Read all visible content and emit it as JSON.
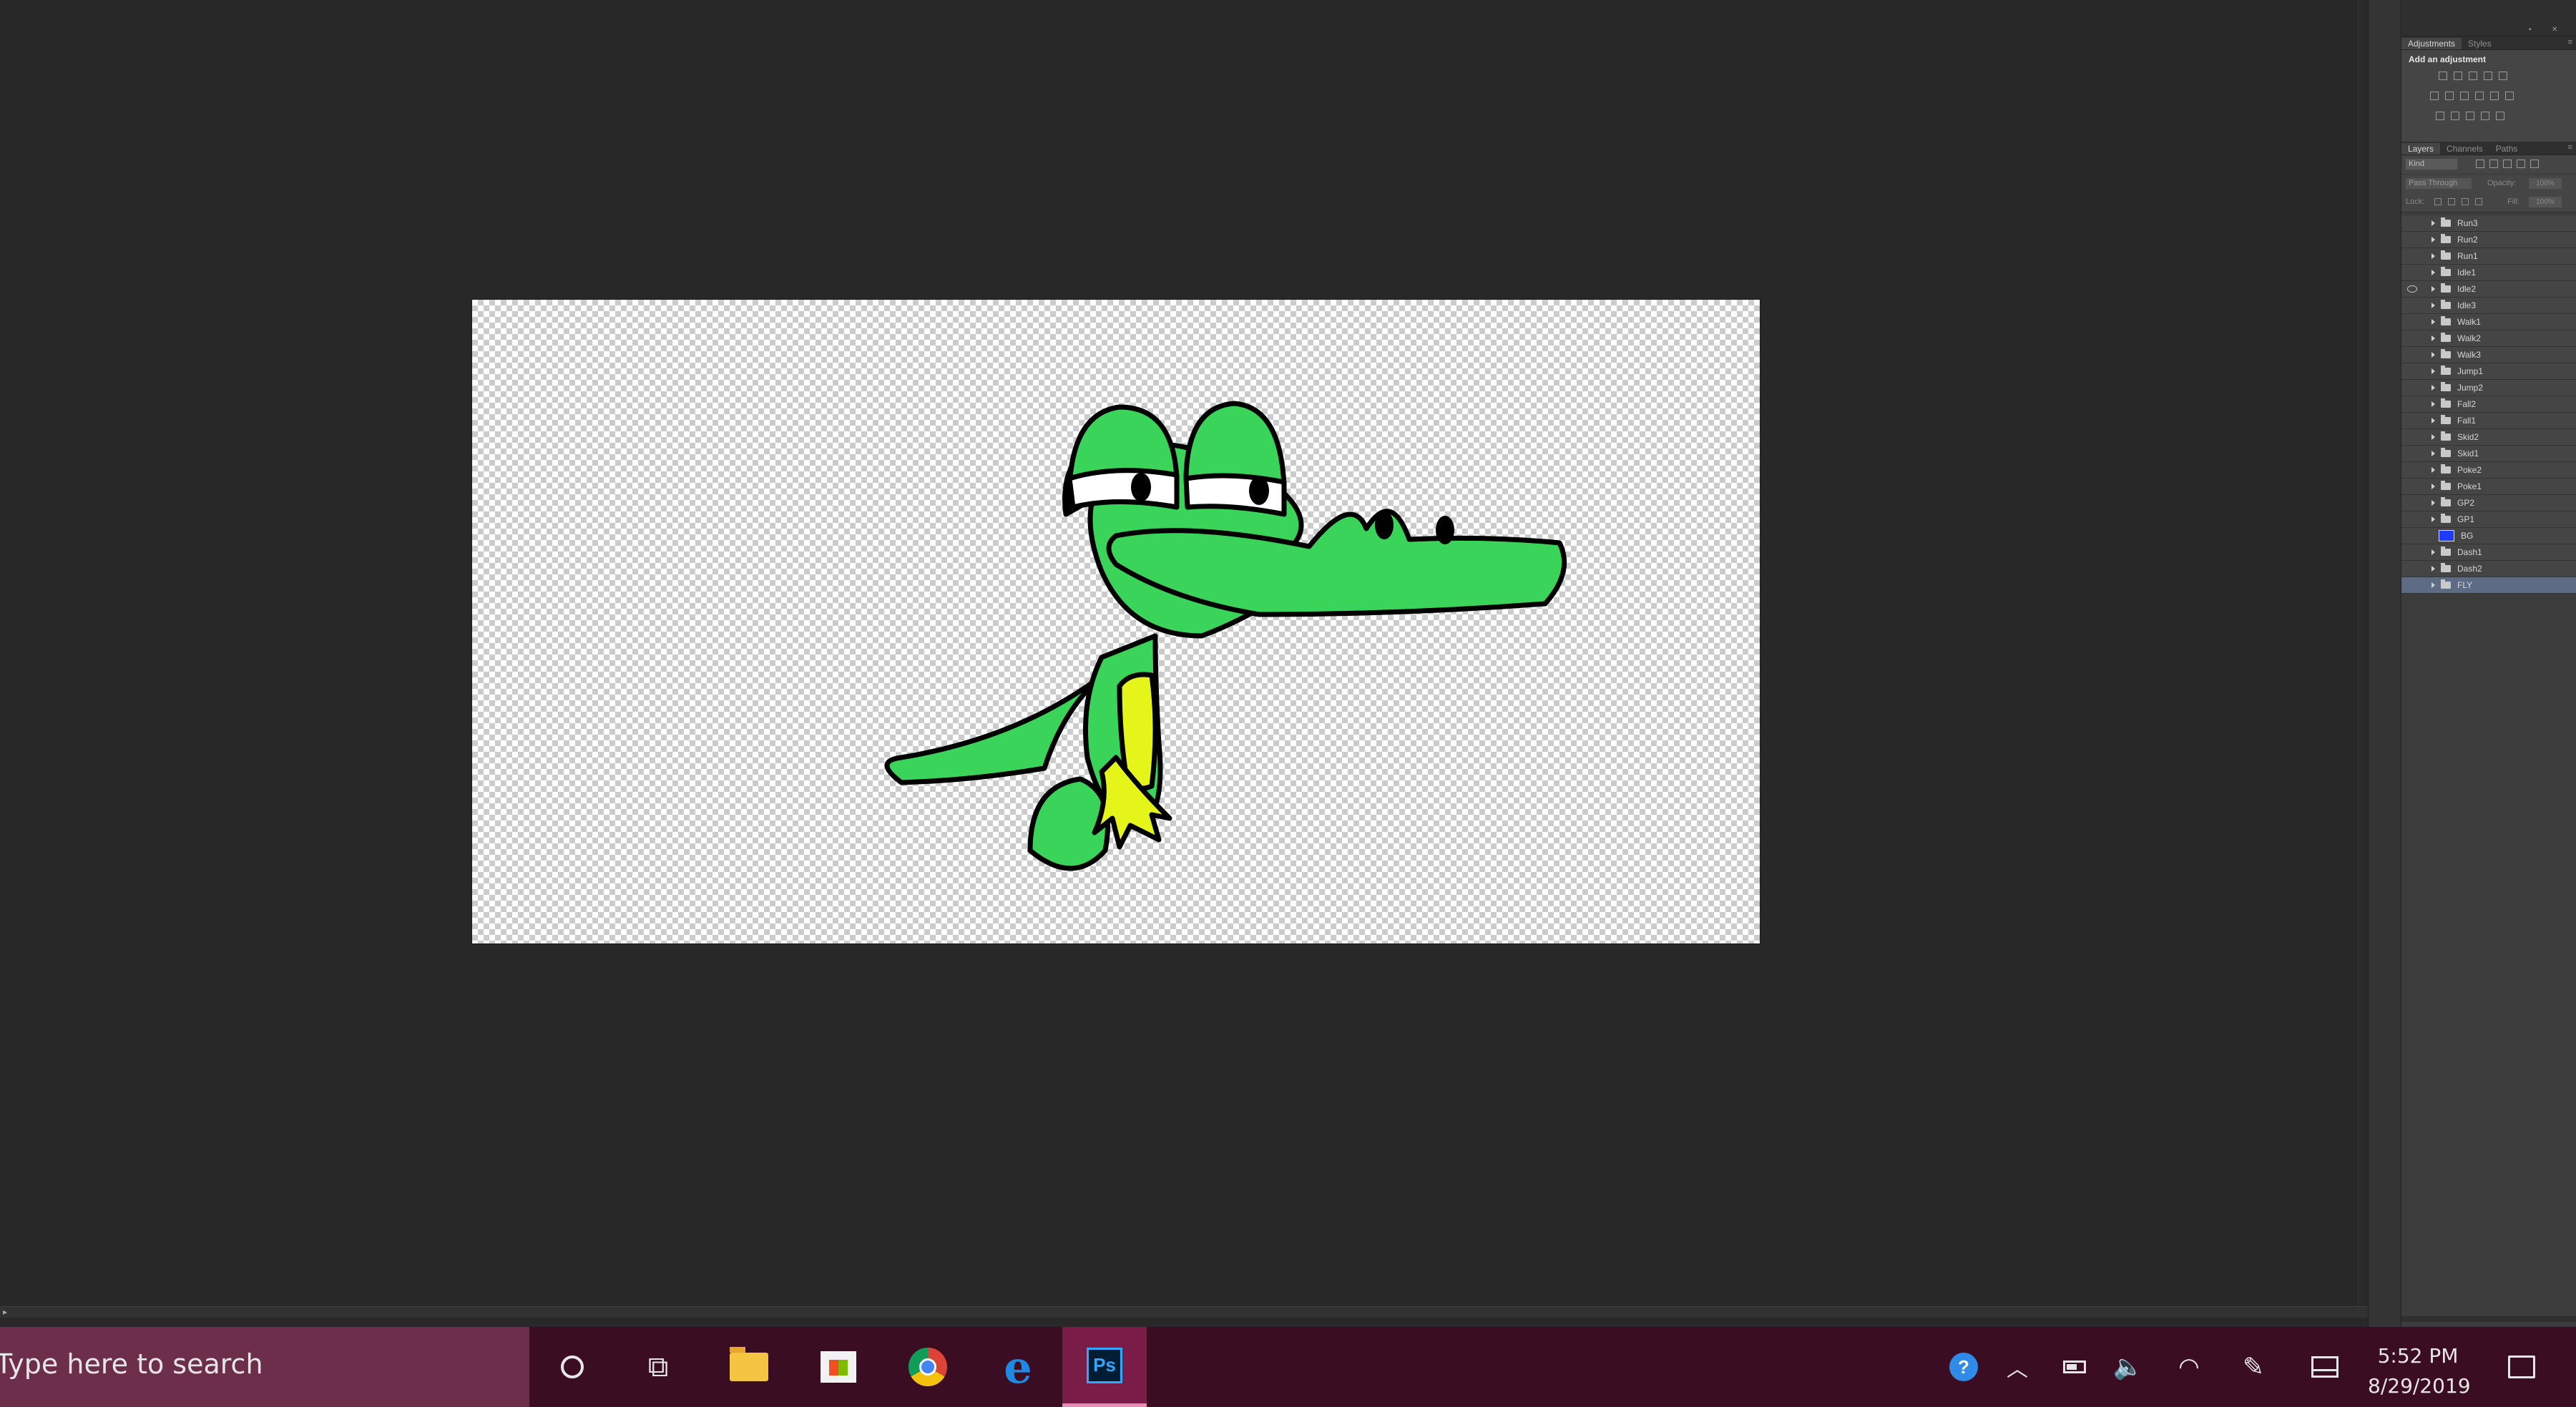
{
  "panels": {
    "top_tabs": [
      {
        "label": "Adjustments"
      },
      {
        "label": "Styles"
      }
    ],
    "adjustments": {
      "title": "Add an adjustment"
    },
    "layers_tabs": [
      {
        "label": "Layers"
      },
      {
        "label": "Channels"
      },
      {
        "label": "Paths"
      }
    ],
    "filter_kind": "Kind",
    "blend_mode": "Pass Through",
    "opacity_label": "Opacity:",
    "opacity_value": "100%",
    "lock_label": "Lock:",
    "fill_label": "Fill:",
    "fill_value": "100%",
    "layers": [
      {
        "name": "Run3"
      },
      {
        "name": "Run2"
      },
      {
        "name": "Run1"
      },
      {
        "name": "Idle1"
      },
      {
        "name": "Idle2",
        "visible": true
      },
      {
        "name": "Idle3"
      },
      {
        "name": "Walk1"
      },
      {
        "name": "Walk2"
      },
      {
        "name": "Walk3"
      },
      {
        "name": "Jump1"
      },
      {
        "name": "Jump2"
      },
      {
        "name": "Fall2"
      },
      {
        "name": "Fall1"
      },
      {
        "name": "Skid2"
      },
      {
        "name": "Skid1"
      },
      {
        "name": "Poke2"
      },
      {
        "name": "Poke1"
      },
      {
        "name": "GP2"
      },
      {
        "name": "GP1"
      },
      {
        "name": "BG",
        "kind": "fill",
        "color": "#1e3cff"
      },
      {
        "name": "Dash1"
      },
      {
        "name": "Dash2"
      },
      {
        "name": "FLY",
        "selected": true
      }
    ]
  },
  "canvas": {
    "artwork": "green-crocodile-character",
    "colors": {
      "body": "#3ad45a",
      "belly": "#e5f51a",
      "outline": "#000000",
      "eye_white": "#ffffff"
    }
  },
  "taskbar": {
    "search_placeholder": "Type here to search",
    "apps": [
      "cortana",
      "task-view",
      "file-explorer",
      "microsoft-store",
      "chrome",
      "edge",
      "photoshop"
    ],
    "active_app": "photoshop",
    "tray_icons": [
      "help",
      "show-hidden-icons",
      "battery",
      "volume",
      "wifi",
      "pen-workspace",
      "tablet-mode",
      "notifications"
    ],
    "time": "5:52 PM",
    "date": "8/29/2019"
  }
}
